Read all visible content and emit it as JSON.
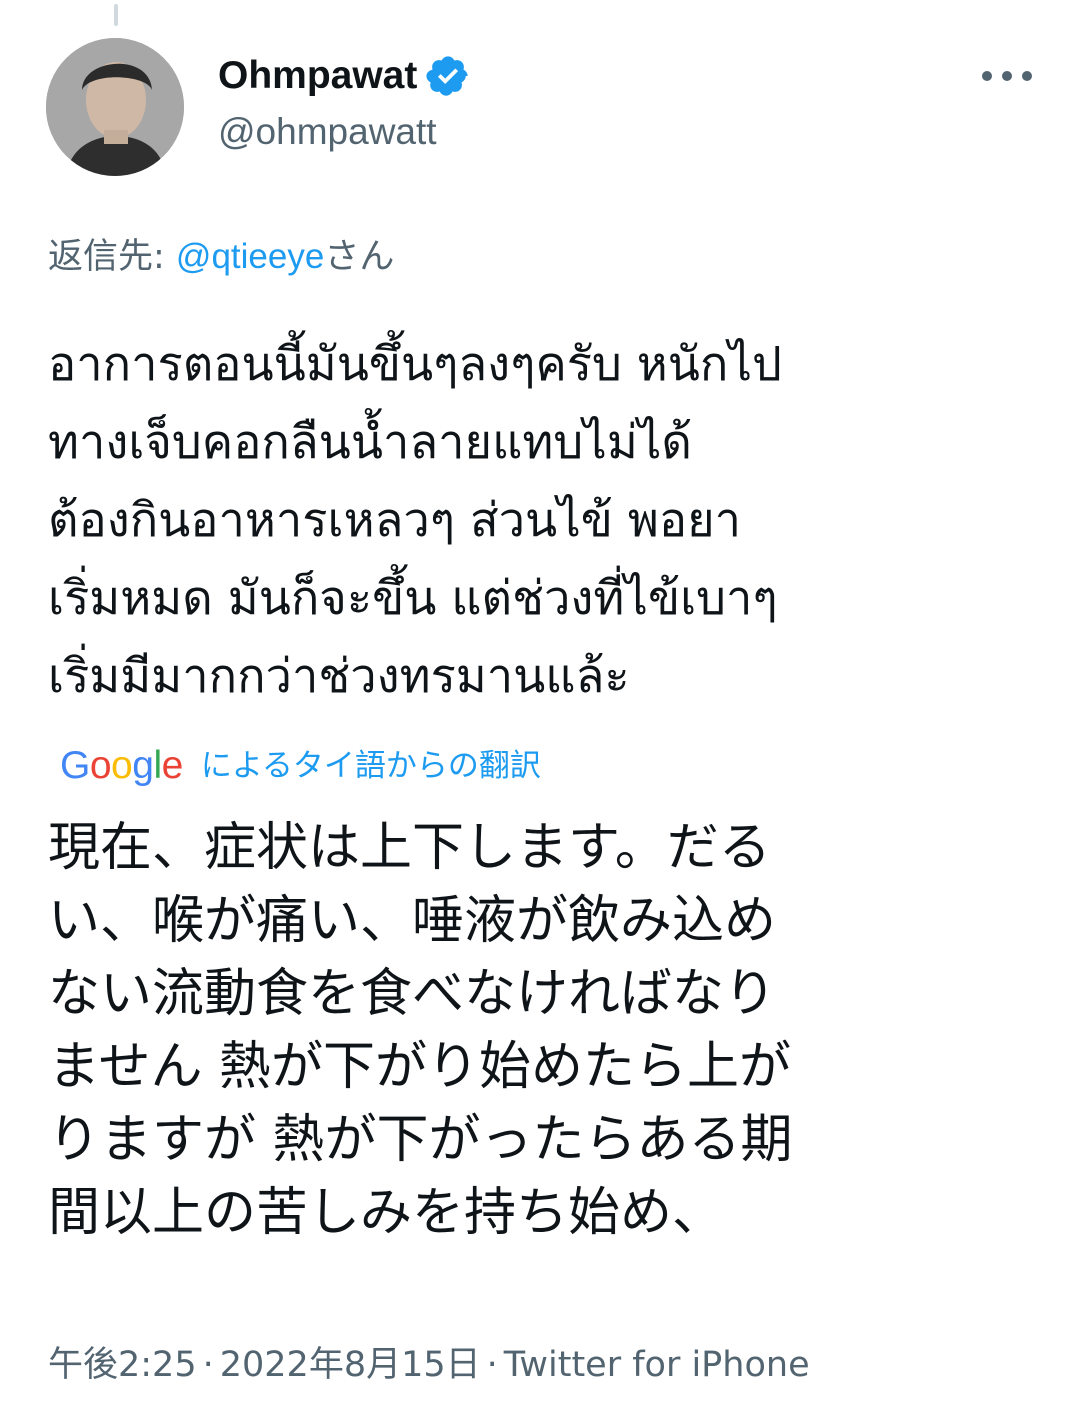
{
  "tweet": {
    "display_name": "Ohmpawat",
    "handle": "@ohmpawatt",
    "verified": true,
    "reply_prefix": "返信先: ",
    "reply_mention": "@qtieeye",
    "reply_suffix": "さん",
    "original_lines": [
      "อาการตอนนี้มันขึ้นๆลงๆครับ หนักไป",
      "ทางเจ็บคอกลืนน้ำลายแทบไม่ได้",
      "ต้องกินอาหารเหลวๆ ส่วนไข้ พอยา",
      "เริ่มหมด มันก็จะขึ้น แต่ช่วงที่ไข้เบาๆ",
      "เริ่มมีมากกว่าช่วงทรมานแล้ะ"
    ],
    "translation": {
      "provider_letters": [
        "G",
        "o",
        "o",
        "g",
        "l",
        "e"
      ],
      "label": "によるタイ語からの翻訳"
    },
    "translated_lines": [
      "現在、症状は上下します。だる",
      "い、喉が痛い、唾液が飲み込め",
      "ない流動食を食べなければなり",
      "ません 熱が下がり始めたら上が",
      "りますが 熱が下がったらある期",
      "間以上の苦しみを持ち始め、"
    ],
    "time": "午後2:25",
    "date": "2022年8月15日",
    "separator": "·",
    "source": "Twitter for iPhone"
  },
  "icons": {
    "verified": "verified-badge-icon",
    "more": "more-options-icon"
  },
  "colors": {
    "accent": "#1d9bf0",
    "text": "#0f1419",
    "secondary": "#536471"
  }
}
